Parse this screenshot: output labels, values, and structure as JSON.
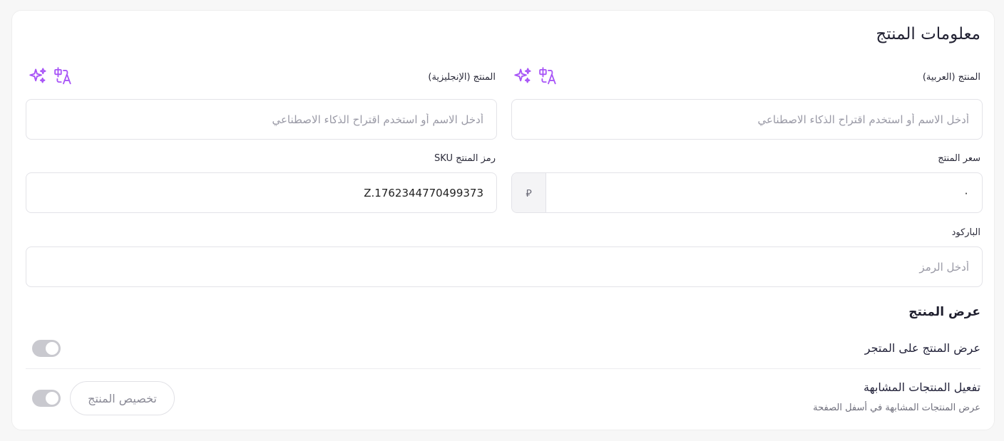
{
  "card": {
    "title": "معلومات المنتج"
  },
  "product_name_ar": {
    "label": "المنتج (العربية)",
    "placeholder": "أدخل الاسم أو استخدم اقتراح الذكاء الاصطناعي",
    "value": ""
  },
  "product_name_en": {
    "label": "المنتج (الإنجليزية)",
    "placeholder": "أدخل الاسم أو استخدم اقتراح الذكاء الاصطناعي",
    "value": ""
  },
  "price": {
    "label": "سعر المنتج",
    "value": "٠",
    "currency_symbol": "⃁"
  },
  "sku": {
    "label": "رمز المنتج SKU",
    "value": "Z.1762344770499373"
  },
  "barcode": {
    "label": "الباركود",
    "placeholder": "أدخل الرمز",
    "value": ""
  },
  "display": {
    "section_title": "عرض المنتج",
    "show_in_store": {
      "label": "عرض المنتج على المتجر",
      "enabled": false
    },
    "similar_products": {
      "label": "تفعيل المنتجات المشابهة",
      "description": "عرض المنتجات المشابهة في أسفل الصفحة",
      "customize_label": "تخصيص المنتج",
      "enabled": false
    }
  },
  "icons": {
    "sparkle": "ai-sparkle-icon",
    "translate": "translate-icon"
  },
  "colors": {
    "accent": "#a855f7",
    "toggle_off": "#c9c9cf"
  }
}
